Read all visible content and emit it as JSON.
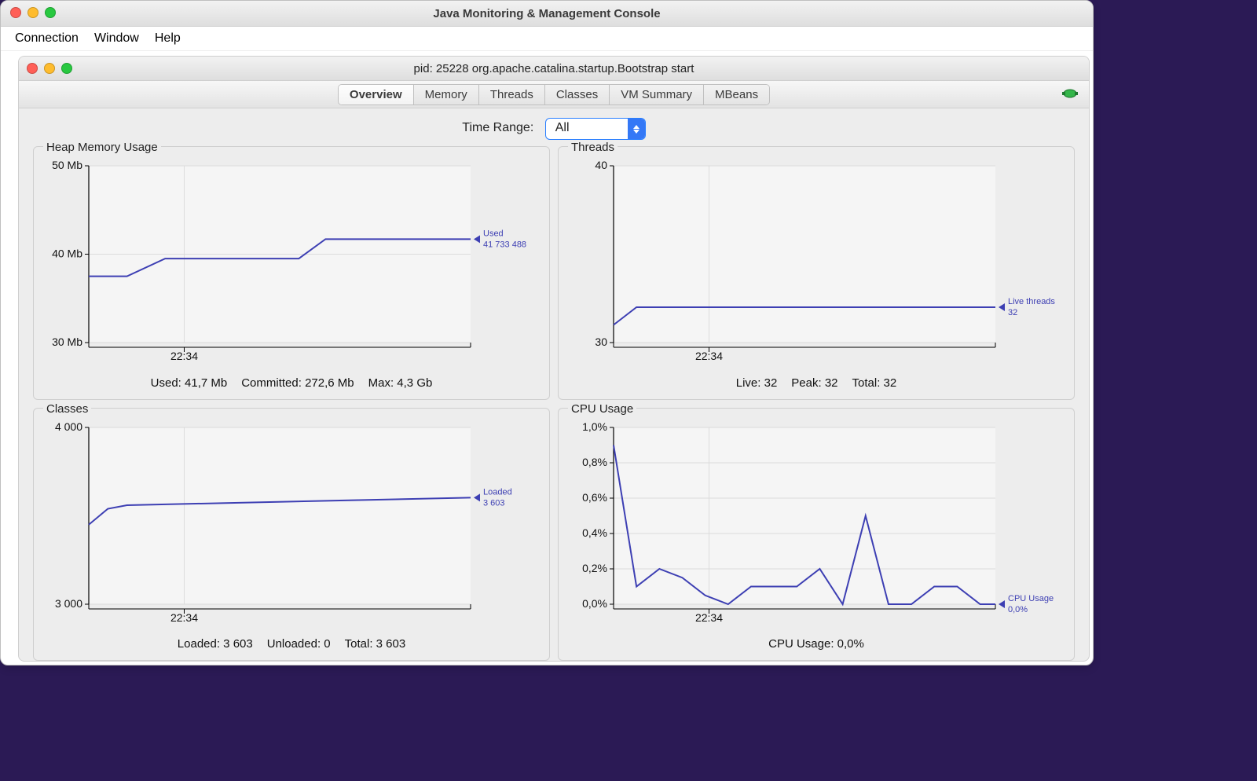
{
  "window": {
    "title": "Java Monitoring & Management Console",
    "menubar": [
      "Connection",
      "Window",
      "Help"
    ],
    "doc_title": "pid: 25228 org.apache.catalina.startup.Bootstrap start",
    "tabs": [
      "Overview",
      "Memory",
      "Threads",
      "Classes",
      "VM Summary",
      "MBeans"
    ],
    "active_tab": "Overview",
    "time_range_label": "Time Range:",
    "time_range_value": "All"
  },
  "charts": {
    "heap": {
      "title": "Heap Memory Usage",
      "marker_title": "Used",
      "marker_value": "41 733 488",
      "x_tick": "22:34",
      "summary": [
        "Used: 41,7 Mb",
        "Committed: 272,6 Mb",
        "Max: 4,3 Gb"
      ]
    },
    "threads": {
      "title": "Threads",
      "marker_title": "Live threads",
      "marker_value": "32",
      "x_tick": "22:34",
      "summary": [
        "Live: 32",
        "Peak: 32",
        "Total: 32"
      ]
    },
    "classes": {
      "title": "Classes",
      "marker_title": "Loaded",
      "marker_value": "3 603",
      "x_tick": "22:34",
      "summary": [
        "Loaded: 3 603",
        "Unloaded: 0",
        "Total: 3 603"
      ]
    },
    "cpu": {
      "title": "CPU Usage",
      "marker_title": "CPU Usage",
      "marker_value": "0,0%",
      "x_tick": "22:34",
      "summary": [
        "CPU Usage: 0,0%"
      ]
    }
  },
  "chart_data": [
    {
      "id": "heap",
      "type": "line",
      "title": "Heap Memory Usage",
      "xlabel": "",
      "ylabel": "",
      "x_ticks": [
        "22:34"
      ],
      "ylim": [
        30,
        50
      ],
      "y_ticks": [
        30,
        40,
        50
      ],
      "y_tick_labels": [
        "30 Mb",
        "40 Mb",
        "50 Mb"
      ],
      "series": [
        {
          "name": "Used",
          "display_value": "41 733 488",
          "x": [
            0,
            0.1,
            0.2,
            0.55,
            0.62,
            1.0
          ],
          "y": [
            37.5,
            37.5,
            39.5,
            39.5,
            41.7,
            41.7
          ]
        }
      ]
    },
    {
      "id": "threads",
      "type": "line",
      "title": "Threads",
      "xlabel": "",
      "ylabel": "",
      "x_ticks": [
        "22:34"
      ],
      "ylim": [
        30,
        40
      ],
      "y_ticks": [
        30,
        40
      ],
      "y_tick_labels": [
        "30",
        "40"
      ],
      "series": [
        {
          "name": "Live threads",
          "display_value": "32",
          "x": [
            0,
            0.06,
            1.0
          ],
          "y": [
            31,
            32,
            32
          ]
        }
      ]
    },
    {
      "id": "classes",
      "type": "line",
      "title": "Classes",
      "xlabel": "",
      "ylabel": "",
      "x_ticks": [
        "22:34"
      ],
      "ylim": [
        3000,
        4000
      ],
      "y_ticks": [
        3000,
        4000
      ],
      "y_tick_labels": [
        "3 000",
        "4 000"
      ],
      "series": [
        {
          "name": "Loaded",
          "display_value": "3 603",
          "x": [
            0,
            0.05,
            0.1,
            1.0
          ],
          "y": [
            3450,
            3540,
            3560,
            3603
          ]
        }
      ]
    },
    {
      "id": "cpu",
      "type": "line",
      "title": "CPU Usage",
      "xlabel": "",
      "ylabel": "",
      "x_ticks": [
        "22:34"
      ],
      "ylim": [
        0,
        1
      ],
      "y_ticks": [
        0,
        0.2,
        0.4,
        0.6,
        0.8,
        1.0
      ],
      "y_tick_labels": [
        "0,0%",
        "0,2%",
        "0,4%",
        "0,6%",
        "0,8%",
        "1,0%"
      ],
      "series": [
        {
          "name": "CPU Usage",
          "display_value": "0,0%",
          "x": [
            0.0,
            0.06,
            0.12,
            0.18,
            0.24,
            0.3,
            0.36,
            0.42,
            0.48,
            0.54,
            0.6,
            0.66,
            0.72,
            0.78,
            0.84,
            0.9,
            0.96,
            1.0
          ],
          "y": [
            0.9,
            0.1,
            0.2,
            0.15,
            0.05,
            0.0,
            0.1,
            0.1,
            0.1,
            0.2,
            0.0,
            0.5,
            0.0,
            0.0,
            0.1,
            0.1,
            0.0,
            0.0
          ]
        }
      ]
    }
  ]
}
